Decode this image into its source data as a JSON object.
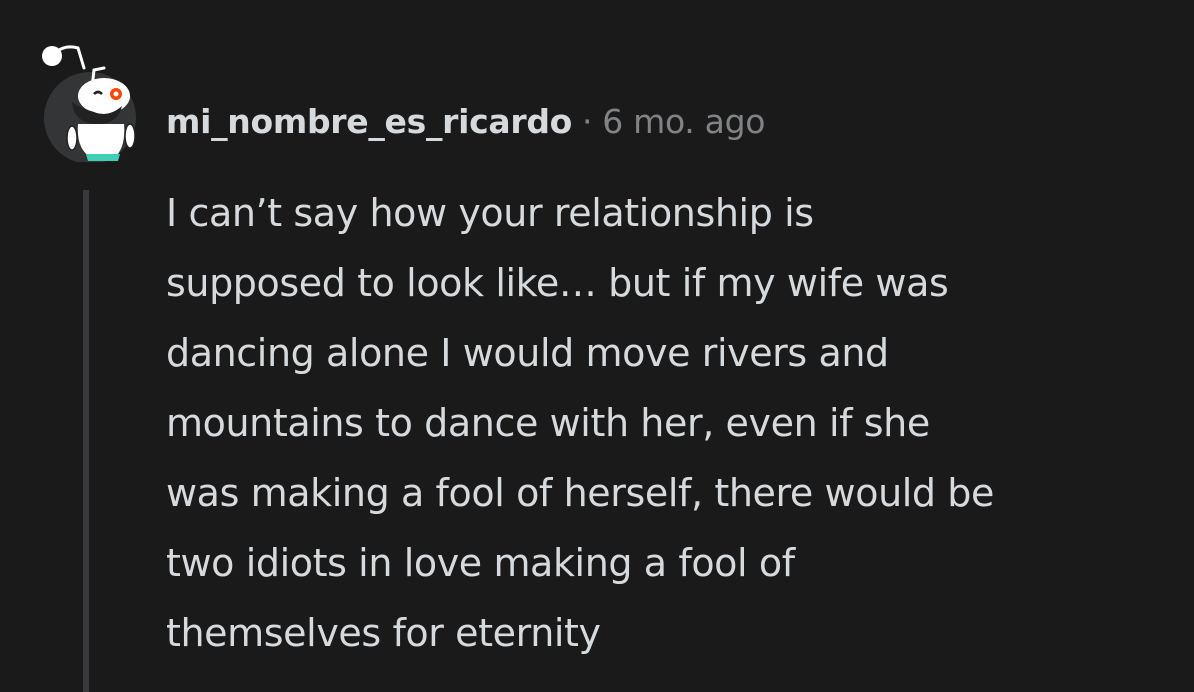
{
  "comment": {
    "username": "mi_nombre_es_ricardo",
    "separator": "·",
    "timestamp": "6 mo. ago",
    "avatar_icon": "snoo-avatar-icon",
    "lines": [
      "I can’t say how your relationship is",
      "supposed to look like… but if my wife was",
      "dancing alone I would move rivers and",
      "mountains to dance with her, even if she",
      "was making a fool of herself, there would be",
      "two idiots in love making a fool of",
      "themselves for eternity"
    ]
  },
  "colors": {
    "background": "#1a1a1b",
    "text": "#d7dadc",
    "meta": "#818384",
    "thread_line": "#3a3a3c",
    "avatar_bg": "#343536",
    "avatar_eye": "#ff4500"
  }
}
